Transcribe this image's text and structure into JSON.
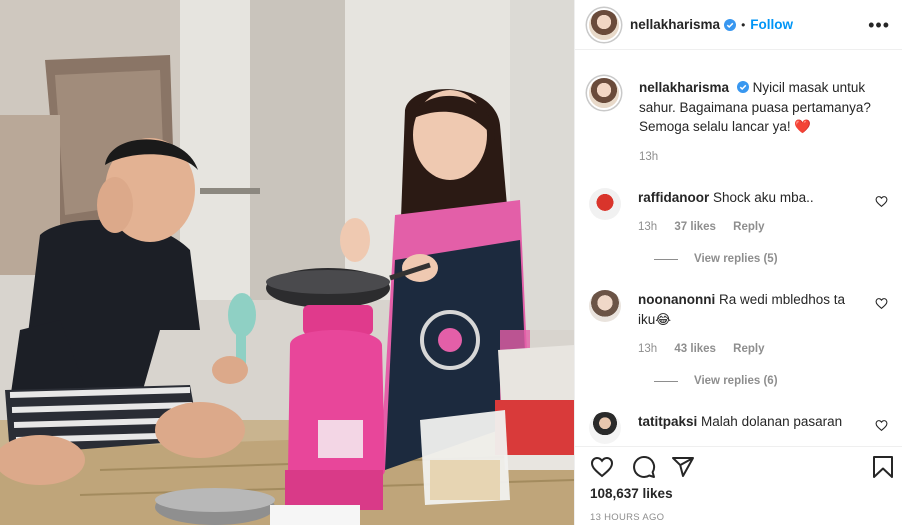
{
  "post": {
    "photo_alt": "",
    "username": "nellakharisma",
    "follow_label": "Follow",
    "separator": "•",
    "more_label": "•••",
    "caption": {
      "username": "nellakharisma",
      "text": "Nyicil masak untuk sahur. Bagaimana puasa pertamanya? Semoga selalu lancar ya! ❤️",
      "time": "13h"
    },
    "comments": [
      {
        "username": "raffidanoor",
        "text": "Shock aku mba..",
        "time": "13h",
        "likes": "37 likes",
        "reply": "Reply",
        "view_replies": "View replies (5)"
      },
      {
        "username": "noonanonni",
        "text": "Ra wedi mbledhos ta iku😂",
        "time": "13h",
        "likes": "43 likes",
        "reply": "Reply",
        "view_replies": "View replies (6)"
      },
      {
        "username": "tatitpaksi",
        "text": "Malah dolanan pasaran"
      }
    ],
    "like_count": "108,637 likes",
    "time_ago": "13 HOURS AGO"
  },
  "colors": {
    "link": "#0095f6",
    "verified": "#3897f0",
    "muted": "#8e8e8e",
    "text": "#262626"
  },
  "icons": [
    "verified-icon",
    "more-options-icon",
    "heart-icon",
    "comment-icon",
    "share-icon",
    "bookmark-icon"
  ]
}
